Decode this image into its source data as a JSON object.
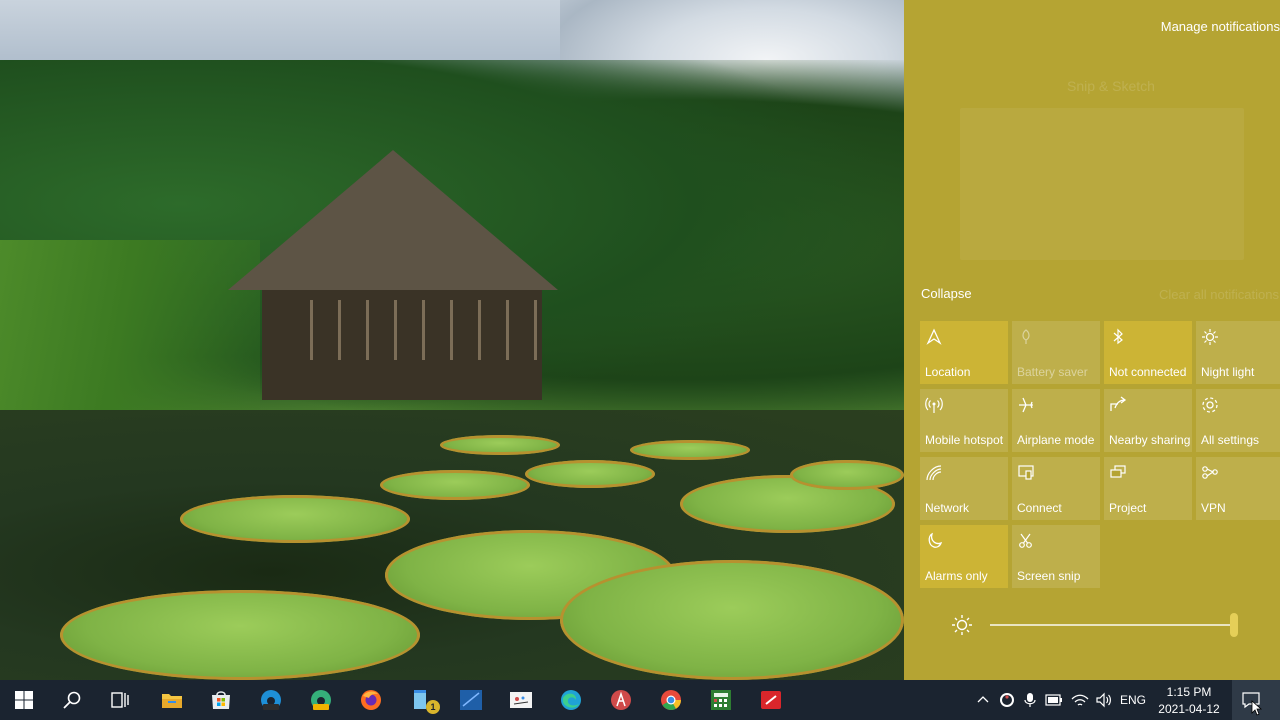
{
  "action_center": {
    "manage_notifications": "Manage notifications",
    "ghost_app_name": "Snip & Sketch",
    "collapse": "Collapse",
    "clear_all": "Clear all notifications",
    "tiles": [
      {
        "label": "Location",
        "icon": "location-icon",
        "state": "on"
      },
      {
        "label": "Battery saver",
        "icon": "battery-saver-icon",
        "state": "disabled"
      },
      {
        "label": "Not connected",
        "icon": "bluetooth-icon",
        "state": "on"
      },
      {
        "label": "Night light",
        "icon": "night-light-icon",
        "state": "off"
      },
      {
        "label": "Mobile hotspot",
        "icon": "hotspot-icon",
        "state": "off"
      },
      {
        "label": "Airplane mode",
        "icon": "airplane-icon",
        "state": "off"
      },
      {
        "label": "Nearby sharing",
        "icon": "share-icon",
        "state": "off"
      },
      {
        "label": "All settings",
        "icon": "gear-icon",
        "state": "off"
      },
      {
        "label": "Network",
        "icon": "network-icon",
        "state": "off"
      },
      {
        "label": "Connect",
        "icon": "connect-icon",
        "state": "off"
      },
      {
        "label": "Project",
        "icon": "project-icon",
        "state": "off"
      },
      {
        "label": "VPN",
        "icon": "vpn-icon",
        "state": "off"
      },
      {
        "label": "Alarms only",
        "icon": "moon-icon",
        "state": "on"
      },
      {
        "label": "Screen snip",
        "icon": "screen-snip-icon",
        "state": "off"
      }
    ],
    "brightness_percent": 100,
    "accent_color": "#b5a433",
    "active_tile_color": "#ccb435"
  },
  "taskbar": {
    "apps": [
      "start-icon",
      "search-icon",
      "task-view-icon",
      "file-explorer-icon",
      "microsoft-store-icon",
      "edge-dev-icon",
      "edge-canary-icon",
      "firefox-icon",
      "notepad-icon",
      "visual-studio-icon",
      "paint-icon",
      "edge-icon",
      "podcast-app-icon",
      "chrome-icon",
      "calculator-icon",
      "app-icon"
    ],
    "notepad_badge": "1",
    "language": "ENG",
    "time": "1:15 PM",
    "date": "2021-04-12"
  }
}
